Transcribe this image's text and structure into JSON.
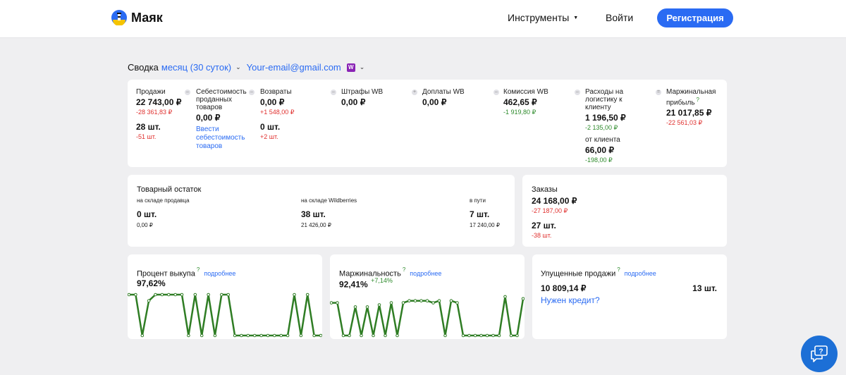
{
  "header": {
    "logo_text": "Маяк",
    "nav_tools": "Инструменты",
    "nav_login": "Войти",
    "register": "Регистрация"
  },
  "summary": {
    "label": "Сводка",
    "period": "месяц (30 суток)",
    "email": "Your-email@gmail.com"
  },
  "metrics": {
    "sales": {
      "label": "Продажи",
      "value": "22 743,00 ₽",
      "delta": "-28 361,83 ₽",
      "count": "28 шт.",
      "count_delta": "-51 шт."
    },
    "cost": {
      "label": "Себестоимость проданных товаров",
      "value": "0,00 ₽",
      "link": "Ввести себестоимость товаров"
    },
    "returns": {
      "label": "Возвраты",
      "value": "0,00 ₽",
      "delta": "+1 548,00 ₽",
      "count": "0 шт.",
      "count_delta": "+2 шт."
    },
    "fines": {
      "label": "Штрафы WB",
      "value": "0,00 ₽"
    },
    "surcharges": {
      "label": "Доплаты WB",
      "value": "0,00 ₽"
    },
    "commission": {
      "label": "Комиссия WB",
      "value": "462,65 ₽",
      "delta": "-1 919,80 ₽"
    },
    "logistics": {
      "label": "Расходы на логистику к клиенту",
      "value": "1 196,50 ₽",
      "delta": "-2 135,00 ₽",
      "from_label": "от клиента",
      "from_value": "66,00 ₽",
      "from_delta": "-198,00 ₽"
    },
    "margin": {
      "label": "Маржинальная прибыль",
      "qmark": "?",
      "value": "21 017,85 ₽",
      "delta": "-22 561,03 ₽"
    }
  },
  "stock": {
    "title": "Товарный остаток",
    "seller": {
      "label": "на складе продавца",
      "count": "0 шт.",
      "sum": "0,00 ₽"
    },
    "wb": {
      "label": "на складе Wildberries",
      "count": "38 шт.",
      "sum": "21 426,00 ₽"
    },
    "transit": {
      "label": "в пути",
      "count": "7 шт.",
      "sum": "17 240,00 ₽"
    }
  },
  "orders": {
    "title": "Заказы",
    "value": "24 168,00 ₽",
    "delta": "-27 187,00 ₽",
    "count": "27 шт.",
    "count_delta": "-38 шт."
  },
  "buyout": {
    "title": "Процент выкупа",
    "qmark": "?",
    "more": "подробнее",
    "value": "97,62%"
  },
  "marginality": {
    "title": "Маржинальность",
    "qmark": "?",
    "more": "подробнее",
    "value": "92,41%",
    "delta": "+7,14%"
  },
  "lost": {
    "title": "Упущенные продажи",
    "qmark": "?",
    "more": "подробнее",
    "value": "10 809,14 ₽",
    "count": "13 шт.",
    "credit": "Нужен кредит?"
  },
  "colors": {
    "accent": "#2a6bf3",
    "line": "#2f7d24",
    "negative": "#e0312f",
    "positive": "#2d8a2b"
  },
  "chart_data": [
    {
      "type": "line",
      "series": [
        {
          "values": [
            1,
            1,
            0,
            0.85,
            1,
            1,
            1,
            1,
            1,
            0,
            1,
            0,
            1,
            0,
            1,
            1,
            0,
            0,
            0,
            0,
            0,
            0,
            0,
            0,
            0,
            1,
            0,
            1,
            0,
            0
          ]
        }
      ]
    },
    {
      "type": "line",
      "series": [
        {
          "values": [
            0.8,
            0.8,
            0,
            0,
            0.7,
            0,
            0.7,
            0,
            0.75,
            0,
            0.8,
            0,
            0.8,
            0.85,
            0.85,
            0.85,
            0.85,
            0.8,
            0.85,
            0,
            0.85,
            0.8,
            0,
            0,
            0,
            0,
            0,
            0,
            0,
            0.95,
            0,
            0,
            0.9
          ]
        }
      ]
    }
  ]
}
